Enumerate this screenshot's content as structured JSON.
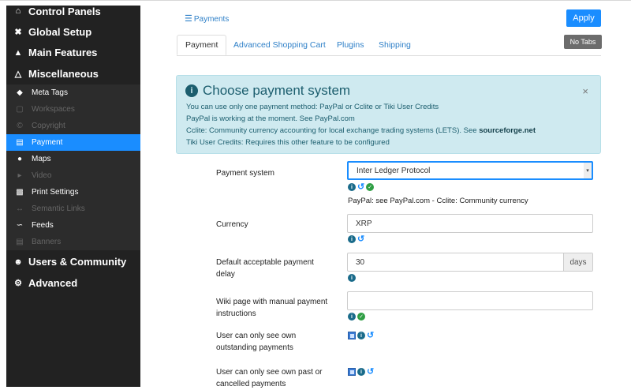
{
  "sidebar": {
    "sections_top": [
      {
        "label": "Control Panels",
        "icon": "home-icon"
      },
      {
        "label": "Global Setup",
        "icon": "tools-icon"
      },
      {
        "label": "Main Features",
        "icon": "bank-icon"
      },
      {
        "label": "Miscellaneous",
        "icon": "flask-icon"
      }
    ],
    "items": [
      {
        "label": "Meta Tags",
        "icon": "tag-icon",
        "state": "normal"
      },
      {
        "label": "Workspaces",
        "icon": "desktop-icon",
        "state": "disabled"
      },
      {
        "label": "Copyright",
        "icon": "copyright-icon",
        "state": "disabled"
      },
      {
        "label": "Payment",
        "icon": "credit-card-icon",
        "state": "active"
      },
      {
        "label": "Maps",
        "icon": "map-marker-icon",
        "state": "normal"
      },
      {
        "label": "Video",
        "icon": "video-icon",
        "state": "disabled"
      },
      {
        "label": "Print Settings",
        "icon": "print-icon",
        "state": "normal"
      },
      {
        "label": "Semantic Links",
        "icon": "arrows-h-icon",
        "state": "disabled"
      },
      {
        "label": "Feeds",
        "icon": "rss-icon",
        "state": "normal"
      },
      {
        "label": "Banners",
        "icon": "banner-icon",
        "state": "disabled"
      }
    ],
    "sections_bottom": [
      {
        "label": "Users & Community",
        "icon": "users-icon"
      },
      {
        "label": "Advanced",
        "icon": "cogs-icon"
      }
    ]
  },
  "header": {
    "breadcrumb": "Payments",
    "apply_label": "Apply",
    "no_tabs_label": "No Tabs"
  },
  "tabs": [
    "Payment",
    "Advanced Shopping Cart",
    "Plugins",
    "Shipping"
  ],
  "alert": {
    "title": "Choose payment system",
    "lines": [
      "You can use only one payment method: PayPal or Cclite or Tiki User Credits",
      "PayPal is working at the moment. See PayPal.com",
      "Cclite: Community currency accounting for local exchange trading systems (LETS). See ",
      "Tiki User Credits: Requires this other feature to be configured"
    ],
    "link": "sourceforge.net",
    "close": "×"
  },
  "form": {
    "payment_system": {
      "label": "Payment system",
      "value": "Inter Ledger Protocol",
      "help": "PayPal: see PayPal.com - Cclite: Community currency"
    },
    "currency": {
      "label": "Currency",
      "value": "XRP"
    },
    "delay": {
      "label": "Default acceptable payment delay",
      "value": "30",
      "addon": "days"
    },
    "wiki_page": {
      "label": "Wiki page with manual payment instructions",
      "value": ""
    },
    "own_outstanding": {
      "label": "User can only see own outstanding payments"
    },
    "own_past": {
      "label": "User can only see own past or cancelled payments"
    }
  }
}
